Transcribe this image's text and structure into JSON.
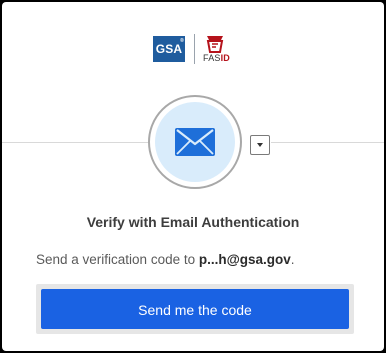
{
  "brand": {
    "gsa_logo_text": "GSA",
    "gsa_registered": "®",
    "fasid_prefix": "FAS",
    "fasid_suffix": "ID"
  },
  "authenticator": {
    "icon": "envelope-icon",
    "dropdown_icon": "caret-down-icon"
  },
  "main": {
    "title": "Verify with Email Authentication",
    "description_prefix": "Send a verification code to ",
    "email_masked": "p...h@gsa.gov",
    "description_suffix": ".",
    "send_button_label": "Send me the code"
  },
  "colors": {
    "primary_button": "#1a62e3",
    "gsa_blue": "#1f5c9e",
    "fas_red": "#b5121b",
    "icon_bg": "#d9ecfb",
    "envelope": "#1e6fd9"
  }
}
